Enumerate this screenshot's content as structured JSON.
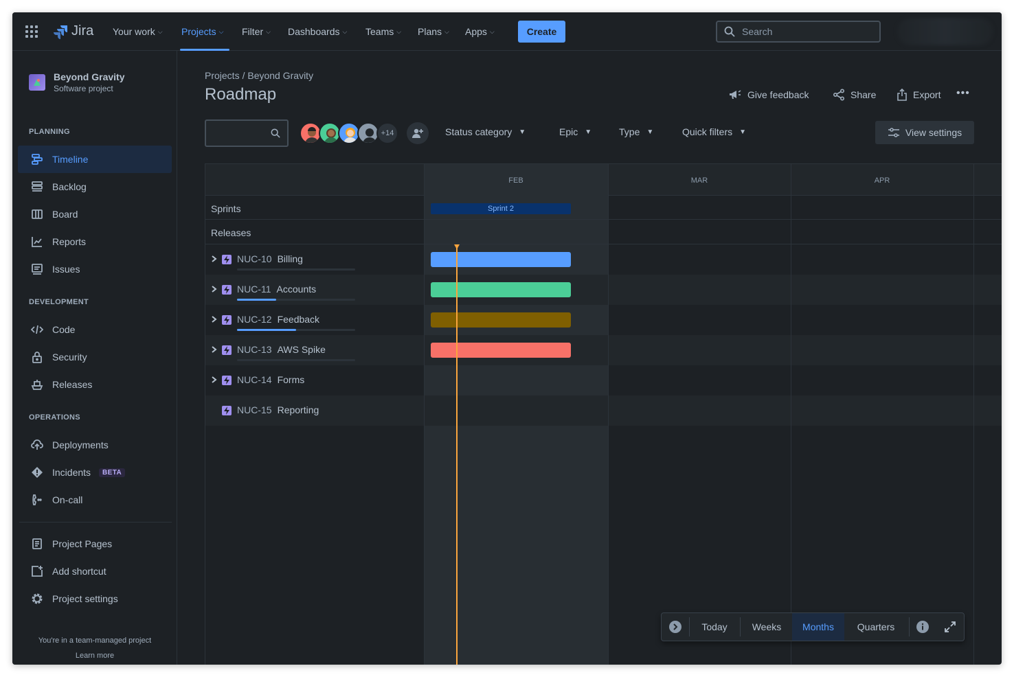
{
  "nav": {
    "logo_text": "Jira",
    "items": [
      {
        "label": "Your work"
      },
      {
        "label": "Projects"
      },
      {
        "label": "Filter"
      },
      {
        "label": "Dashboards"
      },
      {
        "label": "Teams"
      },
      {
        "label": "Plans"
      },
      {
        "label": "Apps"
      }
    ],
    "create_label": "Create",
    "search_placeholder": "Search"
  },
  "sidebar": {
    "project_name": "Beyond Gravity",
    "project_type": "Software project",
    "sections": {
      "planning": "PLANNING",
      "development": "DEVELOPMENT",
      "operations": "OPERATIONS"
    },
    "planning_items": [
      {
        "label": "Timeline",
        "icon": "timeline-icon"
      },
      {
        "label": "Backlog",
        "icon": "backlog-icon"
      },
      {
        "label": "Board",
        "icon": "board-icon"
      },
      {
        "label": "Reports",
        "icon": "reports-icon"
      },
      {
        "label": "Issues",
        "icon": "issues-icon"
      }
    ],
    "development_items": [
      {
        "label": "Code",
        "icon": "code-icon"
      },
      {
        "label": "Security",
        "icon": "lock-icon"
      },
      {
        "label": "Releases",
        "icon": "ship-icon"
      }
    ],
    "operations_items": [
      {
        "label": "Deployments",
        "icon": "cloud-upload-icon"
      },
      {
        "label": "Incidents",
        "icon": "incident-icon",
        "badge": "BETA"
      },
      {
        "label": "On-call",
        "icon": "phone-icon"
      }
    ],
    "bottom_items": [
      {
        "label": "Project Pages",
        "icon": "page-icon"
      },
      {
        "label": "Add shortcut",
        "icon": "add-shortcut-icon"
      },
      {
        "label": "Project settings",
        "icon": "gear-icon"
      }
    ],
    "footer_text": "You're in a team-managed project",
    "footer_link": "Learn more"
  },
  "main": {
    "breadcrumb_root": "Projects",
    "breadcrumb_project": "/ Beyond Gravity",
    "title": "Roadmap",
    "actions": {
      "feedback": "Give feedback",
      "share": "Share",
      "export": "Export",
      "more": "•••"
    },
    "avatar_more": "+14",
    "filters": {
      "status": "Status category",
      "epic": "Epic",
      "type": "Type",
      "quick": "Quick filters",
      "view_settings": "View settings"
    }
  },
  "timeline": {
    "months": [
      "FEB",
      "MAR",
      "APR"
    ],
    "sprints_label": "Sprints",
    "sprint_name": "Sprint 2",
    "releases_label": "Releases",
    "epics": [
      {
        "key": "NUC-10",
        "name": "Billing",
        "progress": 0,
        "has_progress": true,
        "bar_color": "#579dff",
        "has_bar": true,
        "expandable": true
      },
      {
        "key": "NUC-11",
        "name": "Accounts",
        "progress": 0.33,
        "has_progress": true,
        "bar_color": "#4bce97",
        "has_bar": true,
        "expandable": true
      },
      {
        "key": "NUC-12",
        "name": "Feedback",
        "progress": 0.5,
        "has_progress": true,
        "bar_color": "#7f5f01",
        "has_bar": true,
        "expandable": true
      },
      {
        "key": "NUC-13",
        "name": "AWS Spike",
        "progress": 0,
        "has_progress": true,
        "bar_color": "#f87168",
        "has_bar": true,
        "expandable": true
      },
      {
        "key": "NUC-14",
        "name": "Forms",
        "progress": 0,
        "has_progress": false,
        "bar_color": "",
        "has_bar": false,
        "expandable": true
      },
      {
        "key": "NUC-15",
        "name": "Reporting",
        "progress": 0,
        "has_progress": false,
        "bar_color": "",
        "has_bar": false,
        "expandable": false
      }
    ]
  },
  "zoom": {
    "today": "Today",
    "weeks": "Weeks",
    "months": "Months",
    "quarters": "Quarters",
    "selected": "Months"
  }
}
